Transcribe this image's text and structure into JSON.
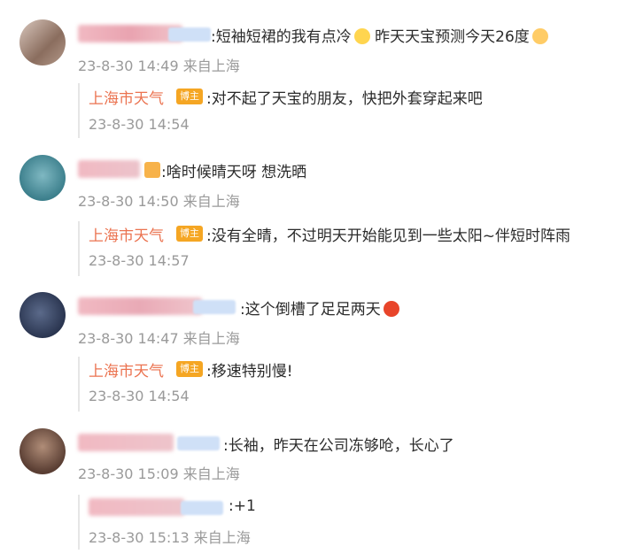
{
  "comments": [
    {
      "text": ":短袖短裙的我有点冷",
      "text_suffix": " 昨天天宝预测今天26度",
      "meta": "23-8-30 14:49 来自上海",
      "reply": {
        "author": "上海市天气",
        "tag": "博主",
        "text": ":对不起了天宝的朋友，快把外套穿起来吧",
        "meta": "23-8-30 14:54"
      }
    },
    {
      "text": ":啥时候晴天呀 想洗晒",
      "meta": "23-8-30 14:50 来自上海",
      "reply": {
        "author": "上海市天气",
        "tag": "博主",
        "text": ":没有全晴，不过明天开始能见到一些太阳~伴短时阵雨",
        "meta": "23-8-30 14:57"
      }
    },
    {
      "text": ":这个倒槽了足足两天",
      "meta": "23-8-30 14:47 来自上海",
      "reply": {
        "author": "上海市天气",
        "tag": "博主",
        "text": ":移速特别慢!",
        "meta": "23-8-30 14:54"
      }
    },
    {
      "text": ":长袖，昨天在公司冻够呛，长心了",
      "meta": "23-8-30 15:09 来自上海",
      "reply": {
        "text": ":+1",
        "meta": "23-8-30 15:13 来自上海"
      }
    }
  ],
  "colors": {
    "author": "#eb7350",
    "tag_bg": "#f5a623",
    "meta": "#9a9a9a"
  }
}
